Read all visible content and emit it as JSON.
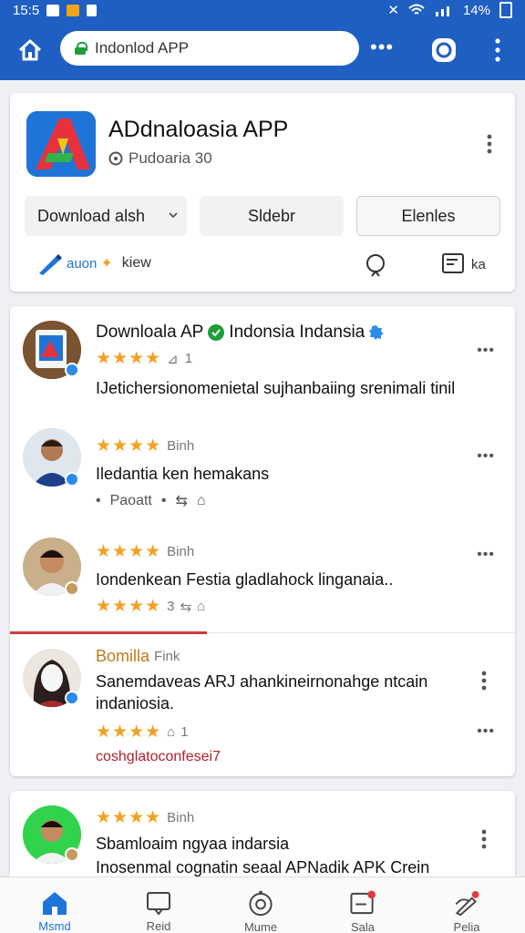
{
  "status_bar": {
    "time": "15:5",
    "battery": "14%"
  },
  "browser": {
    "url_text": "Indonlod APP"
  },
  "app": {
    "title": "ADdnaloasia APP",
    "subtitle": "Pudoaria  30",
    "buttons": {
      "download": "Download  alsh",
      "sidebar": "Sldebr",
      "elenles": "Elenles"
    },
    "action_pen_label": "auon",
    "action_new_label": "kiew",
    "doc_label": "ka"
  },
  "reviews": [
    {
      "title_left": "Downloala AP",
      "title_right": "Indonsia Indansia",
      "stars": "★★★★",
      "meta": "1",
      "text": "IJetichersionomenietal sujhanbaiing srenimali tinil"
    },
    {
      "stars": "★★★★",
      "meta": "Binh",
      "text": "Iledantia ken hemakans",
      "sub_meta": "Paoatt"
    },
    {
      "stars": "★★★★",
      "meta": "Binh",
      "text": "Iondenkean Festia gladlahock linganaia..",
      "stars2": "★★★★",
      "count": "3"
    },
    {
      "name": "Bomilla",
      "name_suffix": "Fink",
      "text": "Sanemdaveas ARJ ahankineirnonahge ntcain indaniosia.",
      "stars": "★★★★",
      "count": "1",
      "link": "coshglatoconfesei7"
    }
  ],
  "last_review": {
    "stars": "★★★★",
    "meta": "Binh",
    "title": "Sbamloaim ngyaa indarsia",
    "text": "Inosenmal cognatin seaal APNadik APK Crein"
  },
  "bottom_nav": [
    "Msmd",
    "Reid",
    "Mume",
    "Sala",
    "Pelia"
  ],
  "colors": {
    "header_blue": "#1f5fc2",
    "star": "#f2a122",
    "link_red": "#b0202a"
  }
}
